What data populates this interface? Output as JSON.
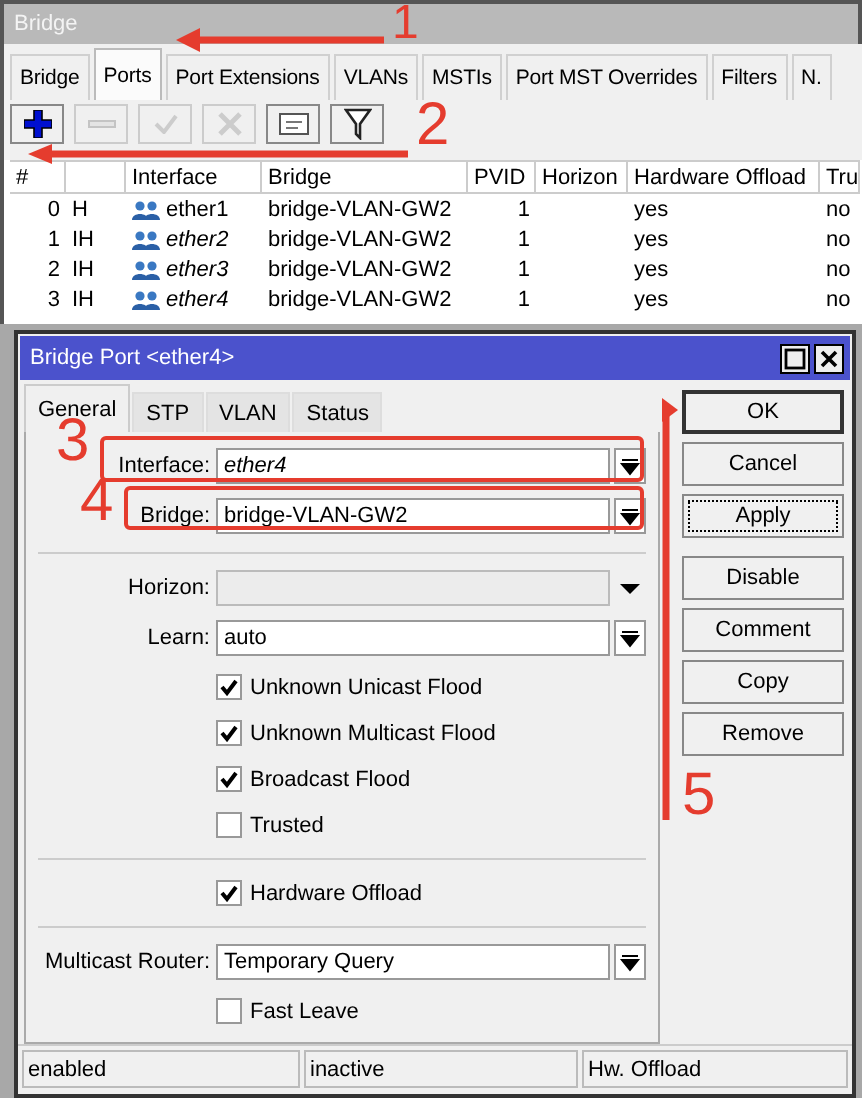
{
  "window": {
    "title": "Bridge"
  },
  "tabs": [
    {
      "label": "Bridge",
      "selected": false
    },
    {
      "label": "Ports",
      "selected": true
    },
    {
      "label": "Port Extensions",
      "selected": false
    },
    {
      "label": "VLANs",
      "selected": false
    },
    {
      "label": "MSTIs",
      "selected": false
    },
    {
      "label": "Port MST Overrides",
      "selected": false
    },
    {
      "label": "Filters",
      "selected": false
    },
    {
      "label": "N.",
      "selected": false
    }
  ],
  "toolbar": [
    {
      "kind": "add",
      "disabled": false
    },
    {
      "kind": "remove",
      "disabled": true
    },
    {
      "kind": "enable",
      "disabled": true
    },
    {
      "kind": "disable",
      "disabled": true
    },
    {
      "kind": "comment",
      "disabled": false
    },
    {
      "kind": "filter",
      "disabled": false
    }
  ],
  "table": {
    "columns": [
      "#",
      "Interface",
      "Bridge",
      "PVID",
      "Horizon",
      "Hardware Offload",
      "Tru"
    ],
    "rows": [
      {
        "index": "0",
        "flags": "H",
        "interface": "ether1",
        "inactive": false,
        "bridge": "bridge-VLAN-GW2",
        "pvid": "1",
        "hardware_offload": "yes",
        "trusted": "no"
      },
      {
        "index": "1",
        "flags": "IH",
        "interface": "ether2",
        "inactive": true,
        "bridge": "bridge-VLAN-GW2",
        "pvid": "1",
        "hardware_offload": "yes",
        "trusted": "no"
      },
      {
        "index": "2",
        "flags": "IH",
        "interface": "ether3",
        "inactive": true,
        "bridge": "bridge-VLAN-GW2",
        "pvid": "1",
        "hardware_offload": "yes",
        "trusted": "no"
      },
      {
        "index": "3",
        "flags": "IH",
        "interface": "ether4",
        "inactive": true,
        "bridge": "bridge-VLAN-GW2",
        "pvid": "1",
        "hardware_offload": "yes",
        "trusted": "no"
      }
    ]
  },
  "dialog": {
    "title": "Bridge Port <ether4>",
    "tabs": [
      {
        "label": "General",
        "selected": true
      },
      {
        "label": "STP",
        "selected": false
      },
      {
        "label": "VLAN",
        "selected": false
      },
      {
        "label": "Status",
        "selected": false
      }
    ],
    "fields": [
      {
        "kind": "select",
        "label": "Interface:",
        "value": "ether4",
        "inactive": true
      },
      {
        "kind": "select",
        "label": "Bridge:",
        "value": "bridge-VLAN-GW2",
        "inactive": false
      },
      {
        "kind": "separator"
      },
      {
        "kind": "input",
        "label": "Horizon:",
        "disabled": true
      },
      {
        "kind": "select",
        "label": "Learn:",
        "value": "auto",
        "inactive": false
      },
      {
        "kind": "checkbox",
        "label": "Unknown Unicast Flood",
        "checked": true
      },
      {
        "kind": "checkbox",
        "label": "Unknown Multicast Flood",
        "checked": true
      },
      {
        "kind": "checkbox",
        "label": "Broadcast Flood",
        "checked": true
      },
      {
        "kind": "checkbox",
        "label": "Trusted",
        "checked": false
      },
      {
        "kind": "separator"
      },
      {
        "kind": "checkbox",
        "label": "Hardware Offload",
        "checked": true
      },
      {
        "kind": "separator"
      },
      {
        "kind": "select",
        "label": "Multicast Router:",
        "value": "Temporary Query",
        "inactive": false
      },
      {
        "kind": "checkbox",
        "label": "Fast Leave",
        "checked": false
      }
    ],
    "buttons": [
      {
        "label": "OK",
        "default": true,
        "focused": false
      },
      {
        "label": "Cancel",
        "default": false,
        "focused": false
      },
      {
        "label": "Apply",
        "default": false,
        "focused": true
      },
      {
        "label": "Disable",
        "default": false,
        "focused": false
      },
      {
        "label": "Comment",
        "default": false,
        "focused": false
      },
      {
        "label": "Copy",
        "default": false,
        "focused": false
      },
      {
        "label": "Remove",
        "default": false,
        "focused": false
      }
    ],
    "status_bar": [
      "enabled",
      "inactive",
      "Hw. Offload"
    ]
  },
  "annotations": [
    {
      "number": "1"
    },
    {
      "number": "2"
    },
    {
      "number": "3"
    },
    {
      "number": "4"
    },
    {
      "number": "5"
    }
  ]
}
